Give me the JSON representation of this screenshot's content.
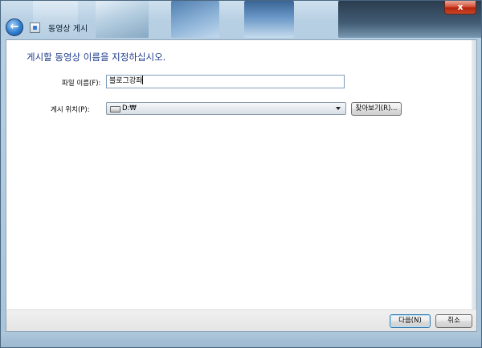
{
  "window": {
    "title": "동영상 게시",
    "close_label": "x"
  },
  "nav": {
    "back_glyph": "←"
  },
  "main": {
    "heading": "게시할 동영상 이름을 지정하십시오.",
    "file_name": {
      "label": "파일 이름(F):",
      "value": "블로그강좌"
    },
    "location": {
      "label": "게시 위치(P):",
      "value": "D:₩",
      "browse_label": "찾아보기(R)..."
    }
  },
  "footer": {
    "next_label": "다음(N)",
    "cancel_label": "취소"
  },
  "colors": {
    "heading": "#1e3d8a",
    "glass": "#b7cfe3"
  }
}
